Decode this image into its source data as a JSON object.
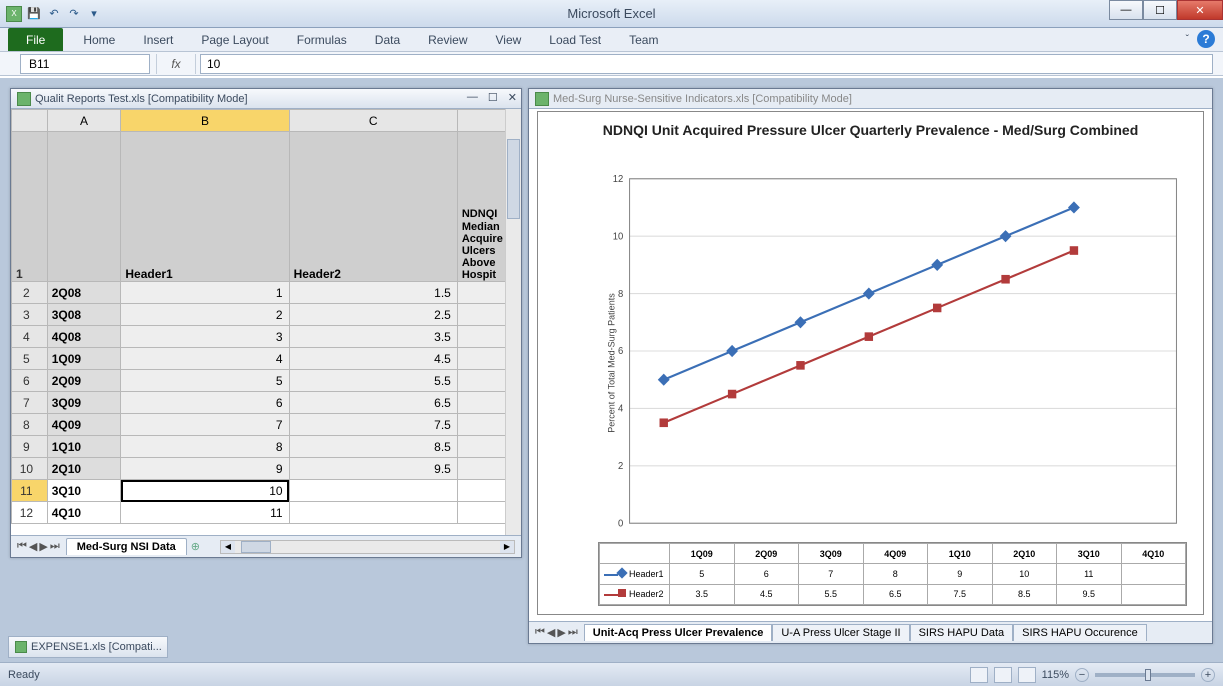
{
  "app": {
    "title": "Microsoft Excel"
  },
  "qat": [
    "save-icon",
    "undo-icon",
    "redo-icon",
    "dropdown-icon"
  ],
  "ribbon": {
    "file": "File",
    "tabs": [
      "Home",
      "Insert",
      "Page Layout",
      "Formulas",
      "Data",
      "Review",
      "View",
      "Load Test",
      "Team"
    ]
  },
  "formula": {
    "namebox": "B11",
    "fx": "fx",
    "value": "10"
  },
  "left_wb": {
    "title": "Qualit Reports Test.xls  [Compatibility Mode]",
    "cols": [
      "A",
      "B",
      "C"
    ],
    "header_row": {
      "B": "Header1",
      "C": "Header2",
      "D": "NDNQI Median Acquire Ulcers Above Hospit"
    },
    "rows": [
      {
        "n": 2,
        "a": "2Q08",
        "b": "1",
        "c": "1.5"
      },
      {
        "n": 3,
        "a": "3Q08",
        "b": "2",
        "c": "2.5"
      },
      {
        "n": 4,
        "a": "4Q08",
        "b": "3",
        "c": "3.5"
      },
      {
        "n": 5,
        "a": "1Q09",
        "b": "4",
        "c": "4.5"
      },
      {
        "n": 6,
        "a": "2Q09",
        "b": "5",
        "c": "5.5"
      },
      {
        "n": 7,
        "a": "3Q09",
        "b": "6",
        "c": "6.5"
      },
      {
        "n": 8,
        "a": "4Q09",
        "b": "7",
        "c": "7.5"
      },
      {
        "n": 9,
        "a": "1Q10",
        "b": "8",
        "c": "8.5"
      },
      {
        "n": 10,
        "a": "2Q10",
        "b": "9",
        "c": "9.5"
      },
      {
        "n": 11,
        "a": "3Q10",
        "b": "10",
        "c": ""
      },
      {
        "n": 12,
        "a": "4Q10",
        "b": "11",
        "c": ""
      }
    ],
    "active_col": "B",
    "active_row": 11,
    "sheet_tab": "Med-Surg NSI Data"
  },
  "right_wb": {
    "title": "Med-Surg Nurse-Sensitive Indicators.xls  [Compatibility Mode]",
    "sheet_tabs": [
      "Unit-Acq Press Ulcer Prevalence",
      "U-A Press Ulcer Stage II",
      "SIRS HAPU Data",
      "SIRS HAPU Occurence"
    ],
    "active_tab": 0
  },
  "chart_data": {
    "type": "line",
    "title": "NDNQI Unit Acquired Pressure Ulcer Quarterly Prevalence - Med/Surg Combined",
    "ylabel": "Percent of Total Med-Surg Patients",
    "xlabel": "",
    "categories": [
      "1Q09",
      "2Q09",
      "3Q09",
      "4Q09",
      "1Q10",
      "2Q10",
      "3Q10",
      "4Q10"
    ],
    "series": [
      {
        "name": "Header1",
        "values": [
          5,
          6,
          7,
          8,
          9,
          10,
          11,
          null
        ],
        "color": "#3b6fb6",
        "marker": "diamond"
      },
      {
        "name": "Header2",
        "values": [
          3.5,
          4.5,
          5.5,
          6.5,
          7.5,
          8.5,
          9.5,
          null
        ],
        "color": "#b23b3b",
        "marker": "square"
      }
    ],
    "ylim": [
      0,
      12
    ],
    "yticks": [
      0,
      2,
      4,
      6,
      8,
      10,
      12
    ]
  },
  "other_wb": "EXPENSE1.xls  [Compati...",
  "status": {
    "left": "Ready",
    "zoom": "115%"
  }
}
